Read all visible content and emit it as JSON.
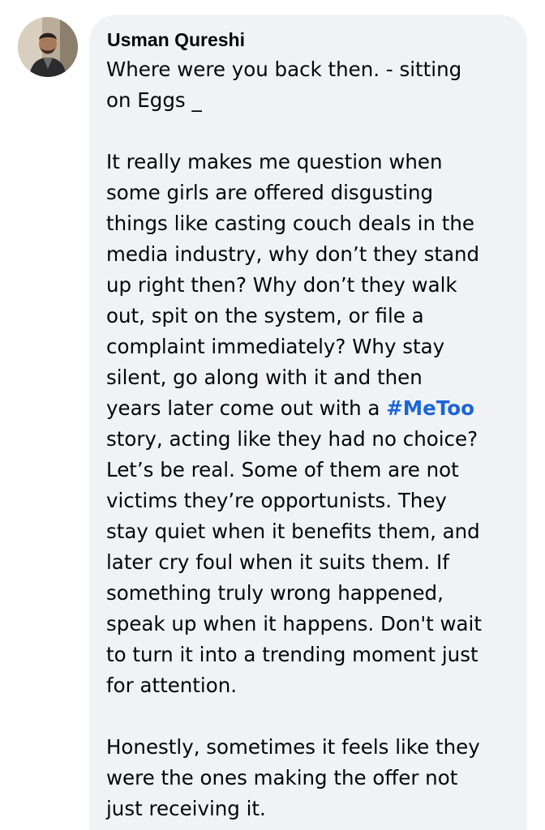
{
  "comment": {
    "author": "Usman Qureshi",
    "avatar_icon": "profile-photo",
    "paragraphs": [
      [
        "Where were you back then. - sitting",
        "on Eggs _"
      ],
      [
        "It really makes me question  when",
        "some girls are offered disgusting",
        "things like casting couch deals in the",
        "media industry, why don’t they stand",
        "up right then? Why don’t they walk",
        "out, spit on the system, or file a",
        "complaint immediately? Why stay",
        "silent, go along with it  and then"
      ],
      [
        "story, acting like they had no choice?",
        "Let’s be real. Some of them are not",
        "victims they’re opportunists. They",
        "stay quiet when it benefits them, and",
        "later cry foul when it suits them. If",
        "something truly wrong happened,",
        "speak up when it happens. Don't wait",
        "to turn it into a trending moment just",
        "for attention."
      ],
      [
        "Honestly, sometimes it feels like they",
        "were the ones making the offer  not",
        "just receiving it."
      ]
    ],
    "hashtag_line_prefix": "years later come out with a ",
    "hashtag": "#MeToo",
    "hashtag_color": "#1b66d8",
    "bubble_color": "#f0f2f5"
  }
}
